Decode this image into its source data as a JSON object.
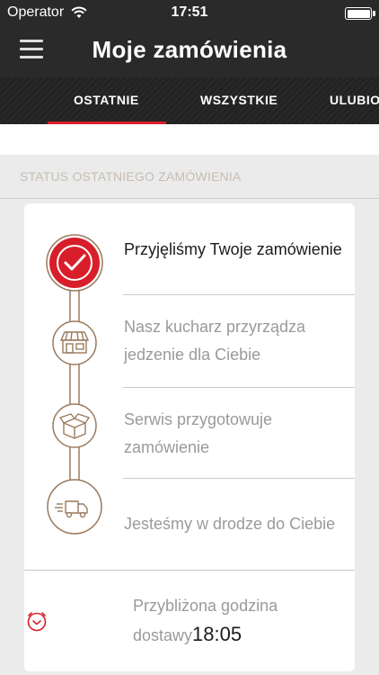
{
  "status_bar": {
    "carrier": "Operator",
    "time": "17:51"
  },
  "header": {
    "title": "Moje zamówienia"
  },
  "tabs": [
    {
      "label": "OSTATNIE",
      "active": true
    },
    {
      "label": "WSZYSTKIE",
      "active": false
    },
    {
      "label": "ULUBIONE",
      "active": false
    }
  ],
  "section": {
    "label": "STATUS OSTATNIEGO ZAMÓWIENIA"
  },
  "steps": [
    {
      "label": "Przyjęliśmy Twoje zamówienie",
      "icon": "check-icon",
      "state": "done"
    },
    {
      "label": "Nasz kucharz przyrządza jedzenie dla Ciebie",
      "icon": "restaurant-icon",
      "state": "pending"
    },
    {
      "label": "Serwis przygotowuje zamówienie",
      "icon": "box-icon",
      "state": "pending"
    },
    {
      "label": "Jesteśmy w drodze do Ciebie",
      "icon": "delivery-truck-icon",
      "state": "pending"
    }
  ],
  "estimate": {
    "label": "Przybliżona godzina dostawy",
    "time": "18:05"
  },
  "colors": {
    "accent": "#d81e2a",
    "timeline": "#9a7a5e",
    "dark_bar": "#2a2a2a"
  }
}
